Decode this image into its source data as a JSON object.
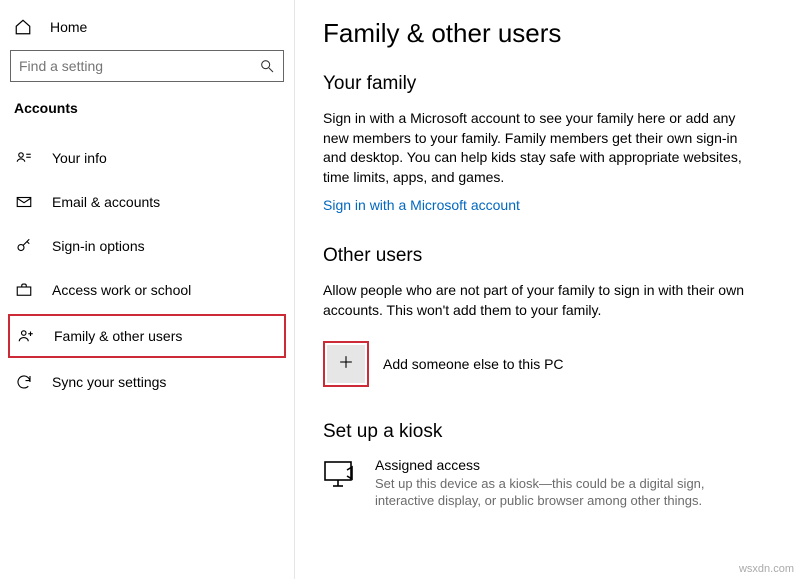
{
  "sidebar": {
    "home": "Home",
    "search_placeholder": "Find a setting",
    "category": "Accounts",
    "items": [
      {
        "label": "Your info"
      },
      {
        "label": "Email & accounts"
      },
      {
        "label": "Sign-in options"
      },
      {
        "label": "Access work or school"
      },
      {
        "label": "Family & other users"
      },
      {
        "label": "Sync your settings"
      }
    ]
  },
  "page": {
    "title": "Family & other users",
    "family": {
      "heading": "Your family",
      "body": "Sign in with a Microsoft account to see your family here or add any new members to your family. Family members get their own sign-in and desktop. You can help kids stay safe with appropriate websites, time limits, apps, and games.",
      "link": "Sign in with a Microsoft account"
    },
    "other": {
      "heading": "Other users",
      "body": "Allow people who are not part of your family to sign in with their own accounts. This won't add them to your family.",
      "add_label": "Add someone else to this PC"
    },
    "kiosk": {
      "heading": "Set up a kiosk",
      "title": "Assigned access",
      "desc": "Set up this device as a kiosk—this could be a digital sign, interactive display, or public browser among other things."
    }
  },
  "watermark": "wsxdn.com"
}
